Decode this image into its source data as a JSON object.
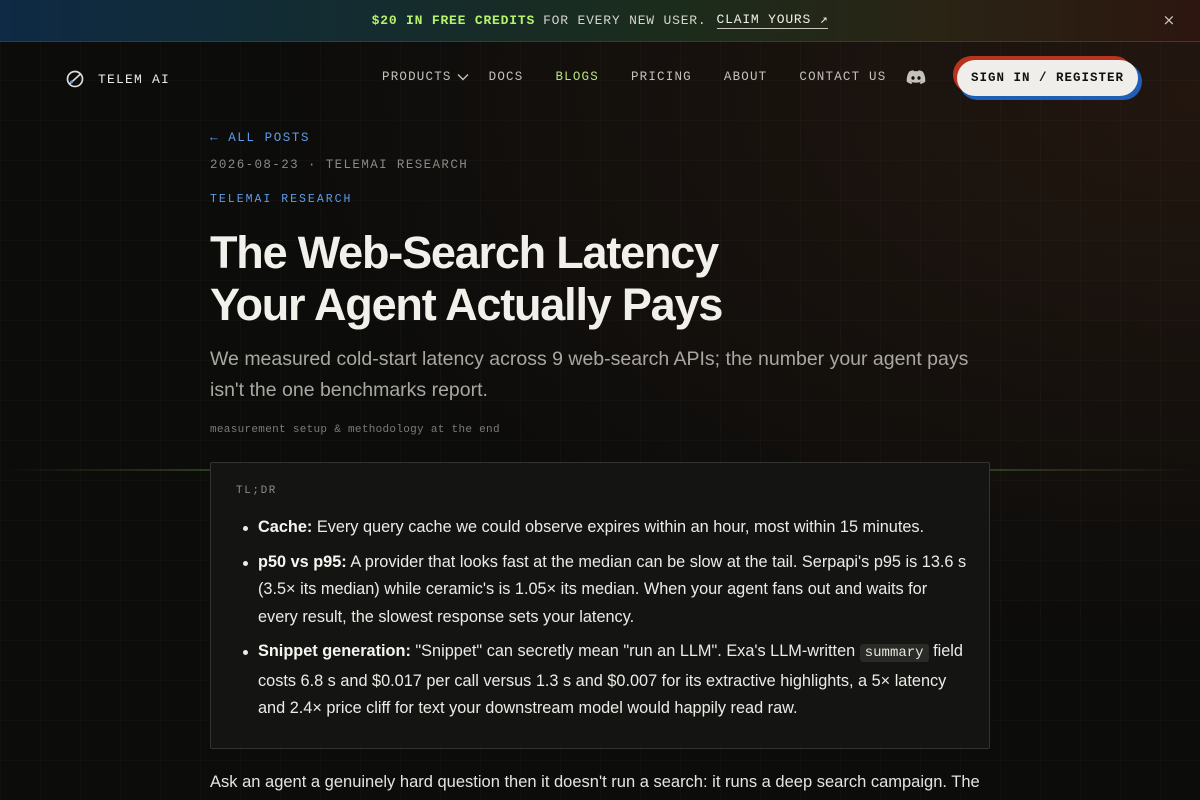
{
  "banner": {
    "credits": "$20 IN FREE CREDITS",
    "rest": "FOR EVERY NEW USER.",
    "claim": "CLAIM YOURS ↗",
    "close": "×"
  },
  "nav": {
    "brand": "TELEM AI",
    "links": {
      "products": "PRODUCTS",
      "docs": "DOCS",
      "blogs": "BLOGS",
      "pricing": "PRICING",
      "about": "ABOUT",
      "contact": "CONTACT US"
    },
    "active": "BLOGS",
    "signin": "SIGN IN / REGISTER"
  },
  "article": {
    "back": "← ALL POSTS",
    "meta": "2026-08-23 · TELEMAI RESEARCH",
    "category": "TELEMAI RESEARCH",
    "title_line1": "The Web-Search Latency",
    "title_line2": "Your Agent Actually Pays",
    "subtitle": "We measured cold-start latency across 9 web-search APIs; the number your agent pays isn't the one benchmarks report.",
    "method_note": "measurement setup & methodology at the end",
    "tldr": {
      "label": "TL;DR",
      "items": [
        {
          "lead": "Cache:",
          "text": "Every query cache we could observe expires within an hour, most within 15 minutes."
        },
        {
          "lead": "p50 vs p95:",
          "text": "A provider that looks fast at the median can be slow at the tail. Serpapi's p95 is 13.6 s (3.5× its median) while ceramic's is 1.05× its median. When your agent fans out and waits for every result, the slowest response sets your latency."
        },
        {
          "lead": "Snippet generation:",
          "text_before": "\"Snippet\" can secretly mean \"run an LLM\". Exa's LLM-written",
          "code": "summary",
          "text_after": "field costs 6.8 s and $0.017 per call versus 1.3 s and $0.007 for its extractive highlights, a 5× latency and 2.4× price cliff for text your downstream model would happily read raw."
        }
      ]
    },
    "body_start": "Ask an agent a genuinely hard question then it doesn't run a search: it runs a deep search campaign. The"
  },
  "colors": {
    "accent_green": "#b5e47a",
    "accent_blue": "#5e9be8",
    "signin_shadow_red": "#b8341f",
    "signin_shadow_blue": "#1f5fb8",
    "background": "#0c0c0b"
  },
  "icons": {
    "brand": "telem-logo-icon",
    "products_dropdown": "chevron-down-icon",
    "discord": "discord-icon",
    "close": "close-icon"
  }
}
